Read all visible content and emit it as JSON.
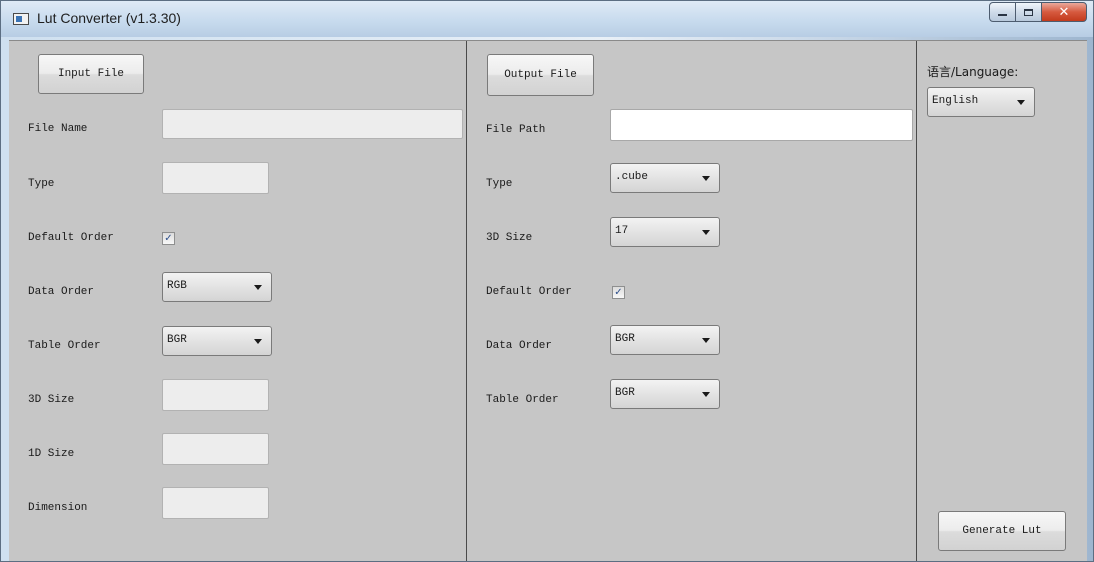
{
  "window": {
    "title": "Lut Converter (v1.3.30)"
  },
  "icons": {
    "app": "lut-converter-app-icon",
    "minimize": "minimize-icon",
    "maximize": "maximize-icon",
    "close": "close-icon",
    "dropdown": "chevron-down-icon",
    "check": "checkmark-icon"
  },
  "input": {
    "button_label": "Input File",
    "file_name_label": "File Name",
    "file_name_value": "",
    "type_label": "Type",
    "type_value": "",
    "default_order_label": "Default Order",
    "default_order_checked": "✓",
    "data_order_label": "Data Order",
    "data_order_value": "RGB",
    "table_order_label": "Table Order",
    "table_order_value": "BGR",
    "size3d_label": "3D Size",
    "size3d_value": "",
    "size1d_label": "1D Size",
    "size1d_value": "",
    "dimension_label": "Dimension",
    "dimension_value": ""
  },
  "output": {
    "button_label": "Output File",
    "file_path_label": "File Path",
    "file_path_value": "",
    "type_label": "Type",
    "type_value": ".cube",
    "size3d_label": "3D Size",
    "size3d_value": "17",
    "default_order_label": "Default Order",
    "default_order_checked": "✓",
    "data_order_label": "Data Order",
    "data_order_value": "BGR",
    "table_order_label": "Table Order",
    "table_order_value": "BGR"
  },
  "settings": {
    "language_label": "语言/Language:",
    "language_value": "English",
    "generate_label": "Generate Lut"
  },
  "colors": {
    "panel": "#c6c6c6",
    "close_button": "#c23a1c",
    "title_bar": "#c8dbee"
  }
}
